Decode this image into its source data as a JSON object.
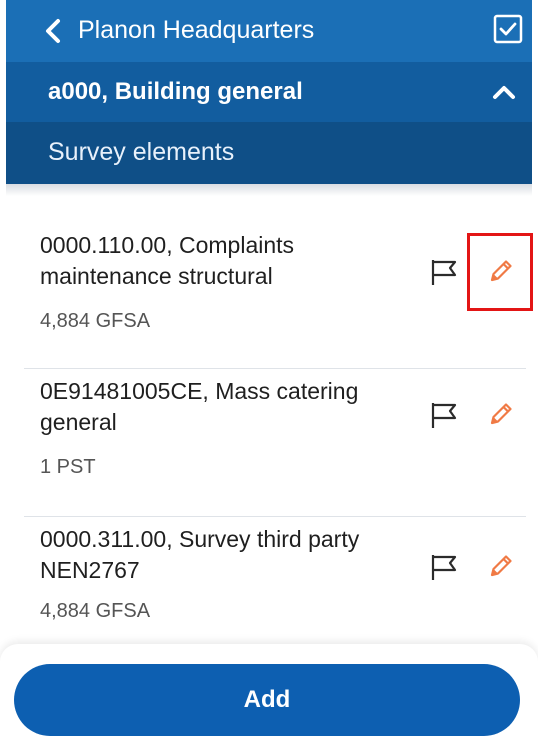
{
  "header": {
    "back_icon": "chevron-left-icon",
    "title": "Planon Headquarters",
    "checkbox_icon": "checkbox-checked-icon"
  },
  "section": {
    "title": "a000, Building general",
    "collapse_icon": "chevron-up-icon"
  },
  "subheader": {
    "title": "Survey elements"
  },
  "items": [
    {
      "title": "0000.110.00, Complaints maintenance structural",
      "meta": "4,884 GFSA",
      "flag_icon": "flag-icon",
      "edit_icon": "pencil-icon"
    },
    {
      "title": "0E91481005CE, Mass catering general",
      "meta": "1 PST",
      "flag_icon": "flag-icon",
      "edit_icon": "pencil-icon"
    },
    {
      "title": "0000.311.00, Survey third party NEN2767",
      "meta": "4,884 GFSA",
      "flag_icon": "flag-icon",
      "edit_icon": "pencil-icon"
    }
  ],
  "footer": {
    "add_label": "Add"
  },
  "colors": {
    "header": "#1b6fb6",
    "section": "#125d9f",
    "subheader": "#0f4f87",
    "button": "#0d5fb1",
    "pencil": "#f07a45",
    "highlight": "#e31515"
  }
}
